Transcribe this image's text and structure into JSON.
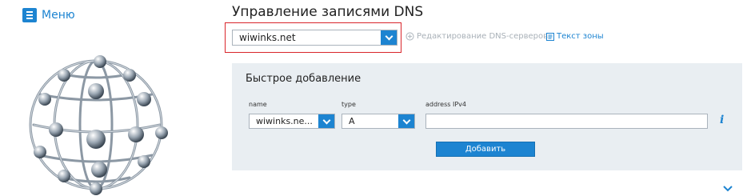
{
  "menu": {
    "label": "Меню",
    "icon": "hamburger-icon"
  },
  "page_title": "Управление записями DNS",
  "domain_select": {
    "value": "wiwinks.net"
  },
  "links": {
    "dns_edit": "Редактирование DNS-серверов",
    "zone_text": "Текст зоны"
  },
  "quick_add": {
    "title": "Быстрое добавление",
    "name_label": "name",
    "name_value": "wiwinks.ne...",
    "type_label": "type",
    "type_value": "A",
    "ipv4_label": "address IPv4",
    "ipv4_value": "",
    "add_button": "Добавить"
  },
  "colors": {
    "accent": "#1d84d1",
    "highlight_border": "#d9262b",
    "panel_bg": "#e9eef2",
    "disabled_link": "#a9b1b8"
  }
}
